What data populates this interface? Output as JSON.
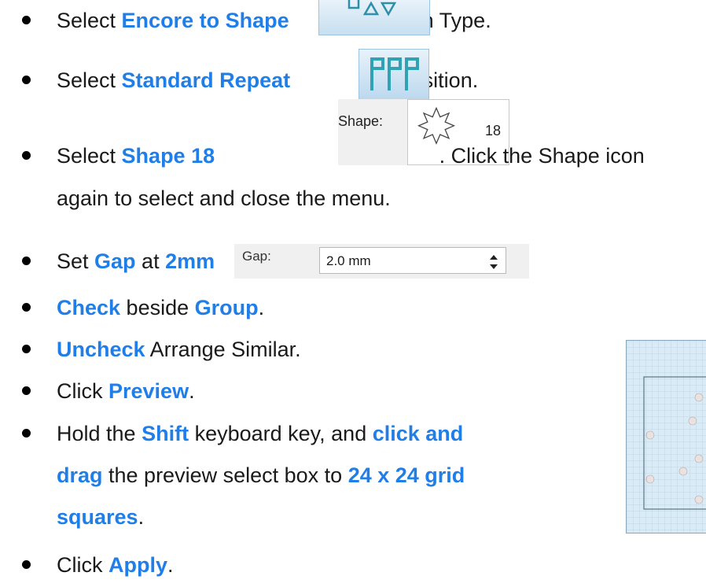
{
  "steps": [
    {
      "pre": "Select ",
      "hl": "Encore to Shape",
      "post": " in Type."
    },
    {
      "pre": "Select ",
      "hl": "Standard Repeat",
      "post": " in Position."
    },
    {
      "pre": "Select ",
      "hl": "Shape 18",
      "post": ".  Click the Shape icon",
      "cont": "again to select and close the menu."
    },
    {
      "pre": "Set ",
      "hl": "Gap",
      "mid": " at ",
      "hl2": "2mm",
      "post": "."
    },
    {
      "hl": "Check",
      "mid": " beside ",
      "hl2": "Group",
      "post": "."
    },
    {
      "hl": "Uncheck",
      "post": " Arrange Similar."
    },
    {
      "pre": "Click ",
      "hl": "Preview",
      "post": "."
    },
    {
      "pre": "Hold the ",
      "hl": "Shift",
      "mid": " keyboard key, and ",
      "hl2": "click and",
      "line2_hl": "drag",
      "line2_mid": " the preview select box to ",
      "line2_hl2": "24 x 24 grid",
      "line3_hl": "squares",
      "line3_post": "."
    },
    {
      "pre": "Click ",
      "hl": "Apply",
      "post": "."
    }
  ],
  "widgets": {
    "shape_label": "Shape:",
    "shape_number": "18",
    "gap_label": "Gap:",
    "gap_value": "2.0 mm"
  },
  "colors": {
    "highlight": "#1f7ee8",
    "button_bg": "#c7dff0",
    "icon_teal": "#3aa8b8"
  },
  "icons": [
    "encore-to-shape-icon",
    "standard-repeat-icon",
    "star-shape-18-icon",
    "spinner-icon"
  ]
}
